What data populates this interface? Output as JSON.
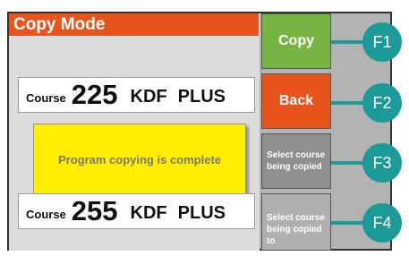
{
  "title": "Copy Mode",
  "courses": [
    {
      "label": "Course",
      "number": "225",
      "unit": "KDF",
      "suffix": "PLUS"
    },
    {
      "label": "Course",
      "number": "255",
      "unit": "KDF",
      "suffix": "PLUS"
    }
  ],
  "popup": {
    "message": "Program copying is complete"
  },
  "buttons": [
    {
      "label": "Copy",
      "color": "#76b543"
    },
    {
      "label": "Back",
      "color": "#e8541c"
    },
    {
      "label": "Select course being copied",
      "color": "#8f8f8f"
    },
    {
      "label": "Select course being copied to",
      "color": "#b0b0b0"
    }
  ],
  "function_keys": [
    "F1",
    "F2",
    "F3",
    "F4"
  ],
  "colors": {
    "title_bar": "#e8541c",
    "function_key": "#1c9a97",
    "popup": "#ffee00"
  }
}
